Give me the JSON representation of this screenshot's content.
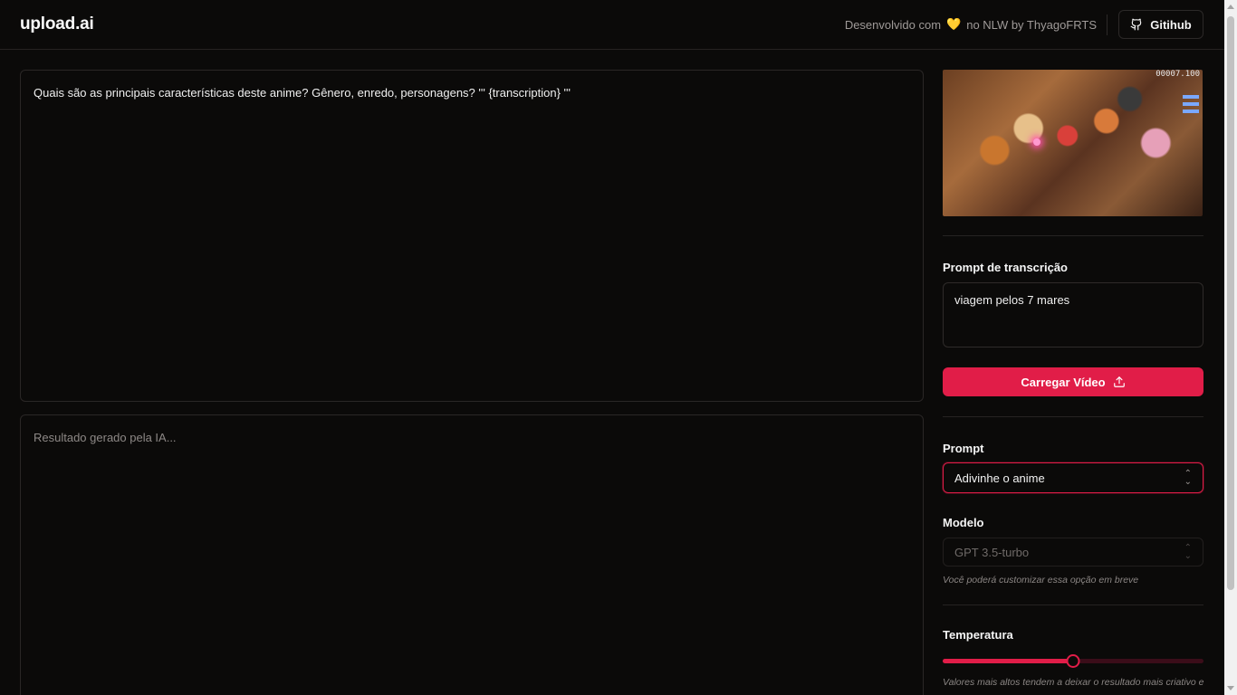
{
  "header": {
    "logo": "upload.ai",
    "credit_prefix": "Desenvolvido com",
    "credit_heart": "💛",
    "credit_suffix": "no NLW by ThyagoFRTS",
    "github_label": "Gitihub"
  },
  "main": {
    "prompt_text": "Quais são as principais características deste anime? Gênero, enredo, personagens? ''' {transcription} '''",
    "result_placeholder": "Resultado gerado pela IA..."
  },
  "sidebar": {
    "video_score": "00007.100",
    "transcription_label": "Prompt de transcrição",
    "transcription_value": "viagem pelos 7 mares",
    "upload_label": "Carregar Vídeo",
    "prompt_label": "Prompt",
    "prompt_selected": "Adivinhe o anime",
    "model_label": "Modelo",
    "model_selected": "GPT 3.5-turbo",
    "model_hint": "Você poderá customizar essa opção em breve",
    "temperature_label": "Temperatura",
    "temperature_value": 0.5,
    "temperature_hint": "Valores mais altos tendem a deixar o resultado mais criativo e"
  },
  "colors": {
    "accent": "#e11d48",
    "background": "#0b0a09",
    "border": "#2a2726"
  },
  "icons": {
    "github": "github-icon",
    "upload": "upload-icon",
    "heart": "heart-icon",
    "chevron": "chevron-up-down-icon"
  }
}
